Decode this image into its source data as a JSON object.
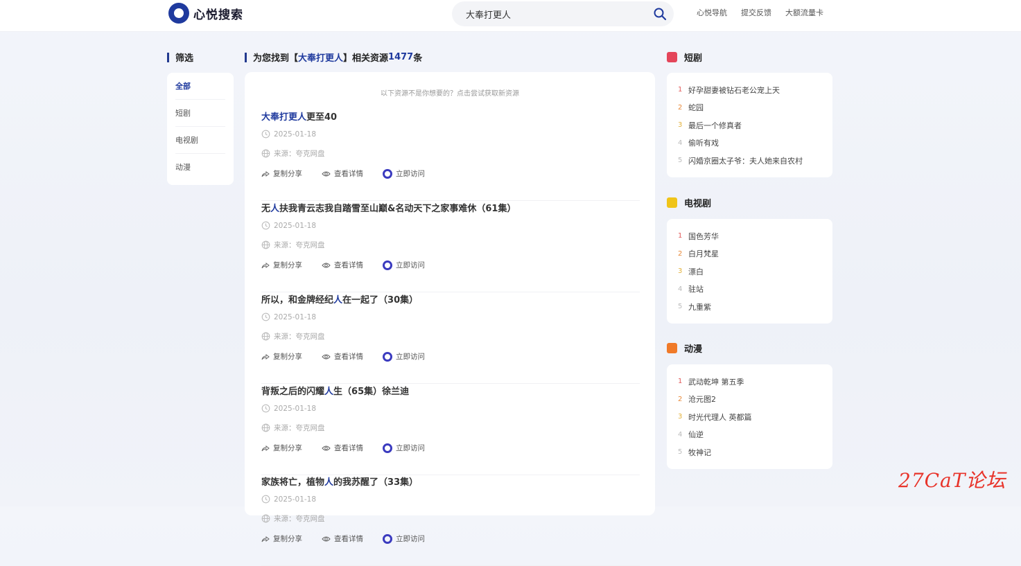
{
  "header": {
    "logo_text": "心悦搜索",
    "search_value": "大奉打更人",
    "nav": [
      "心悦导航",
      "提交反馈",
      "大额流量卡"
    ]
  },
  "filter": {
    "title": "筛选",
    "items": [
      "全部",
      "短剧",
      "电视剧",
      "动漫"
    ]
  },
  "results": {
    "title_prefix": "为您找到【",
    "keyword": "大奉打更人",
    "title_mid": "】相关资源 ",
    "count": "1477",
    "title_suffix": " 条",
    "hint": "以下资源不是你想要的？点击尝试获取新资源",
    "action_share": "复制分享",
    "action_detail": "查看详情",
    "action_visit": "立即访问",
    "items": [
      {
        "title_kw": "大奉打更人",
        "title_rest": "更至40",
        "date": "2025-01-18",
        "source": "来源：夸克网盘"
      },
      {
        "title_pre": "无",
        "title_kw": "人",
        "title_rest": "扶我青云志我自踏雪至山巅&名动天下之家事难休（61集）",
        "date": "2025-01-18",
        "source": "来源：夸克网盘"
      },
      {
        "title_pre": "所以，和金牌经纪",
        "title_kw": "人",
        "title_rest": "在一起了（30集）",
        "date": "2025-01-18",
        "source": "来源：夸克网盘"
      },
      {
        "title_pre": "背叛之后的闪耀",
        "title_kw": "人",
        "title_rest": "生（65集）徐兰迪",
        "date": "2025-01-18",
        "source": "来源：夸克网盘"
      },
      {
        "title_pre": "家族将亡，植物",
        "title_kw": "人",
        "title_rest": "的我苏醒了（33集）",
        "date": "2025-01-18",
        "source": "来源：夸克网盘"
      }
    ]
  },
  "rankings": [
    {
      "title": "短剧",
      "icon": "play-icon",
      "color": "#e4455a",
      "items": [
        "好孕甜妻被钻石老公宠上天",
        "蛇园",
        "最后一个修真者",
        "偷听有戏",
        "闪婚京圈太子爷：夫人她来自农村"
      ]
    },
    {
      "title": "电视剧",
      "icon": "tv-icon",
      "color": "#f0c419",
      "items": [
        "国色芳华",
        "白月梵星",
        "漂白",
        "驻站",
        "九重紫"
      ]
    },
    {
      "title": "动漫",
      "icon": "anime-icon",
      "color": "#f07a28",
      "items": [
        "武动乾坤 第五季",
        "沧元图2",
        "时光代理人 英都篇",
        "仙逆",
        "牧神记"
      ]
    }
  ],
  "watermark": "27CaT论坛"
}
